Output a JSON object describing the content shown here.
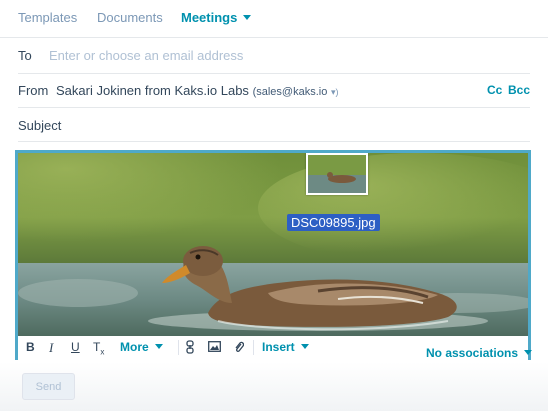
{
  "tabs": [
    {
      "label": "Templates"
    },
    {
      "label": "Documents"
    },
    {
      "label": "Meetings"
    }
  ],
  "to": {
    "label": "To",
    "placeholder": "Enter or choose an email address"
  },
  "from": {
    "label": "From",
    "name": "Sakari Jokinen from Kaks.io Labs",
    "email": "(sales@kaks.io",
    "caret": "▾)"
  },
  "cc_label": "Cc",
  "bcc_label": "Bcc",
  "subject": {
    "label": "Subject"
  },
  "attachment": {
    "filename": "DSC09895.jpg"
  },
  "toolbar": {
    "bold": "B",
    "italic": "I",
    "underline": "U",
    "clear_format": "T",
    "clear_format_sub": "x",
    "more": "More",
    "insert": "Insert",
    "associations": "No associations"
  },
  "footer": {
    "send_label": "Send"
  },
  "colors": {
    "accent": "#0091ae",
    "selection": "#4fa9c9",
    "filename_bg": "#2d5fc4"
  },
  "icons": [
    "chevron-down-icon",
    "link-icon",
    "image-icon",
    "paperclip-icon"
  ]
}
